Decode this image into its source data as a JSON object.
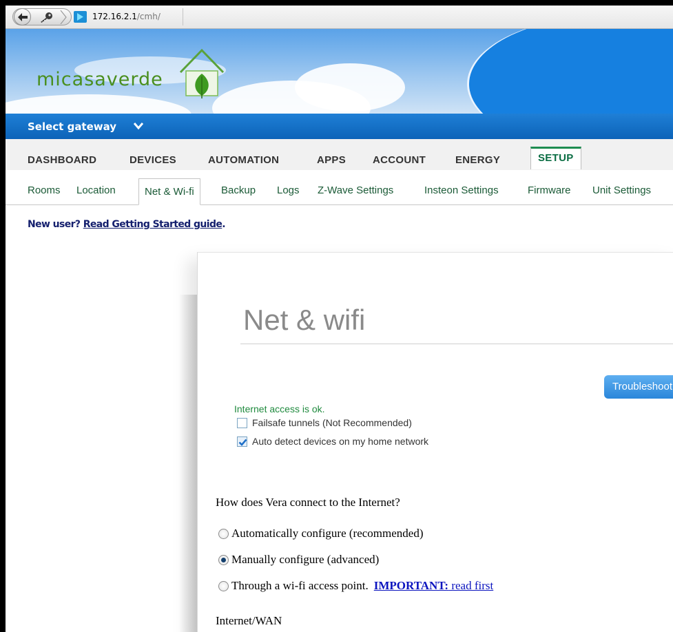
{
  "browser": {
    "url_host": "172.16.2.1",
    "url_path": "/cmh/"
  },
  "header": {
    "logo_text": "micasaverde"
  },
  "gateway": {
    "label": "Select gateway"
  },
  "main_tabs": [
    {
      "label": "DASHBOARD"
    },
    {
      "label": "DEVICES"
    },
    {
      "label": "AUTOMATION"
    },
    {
      "label": "APPS"
    },
    {
      "label": "ACCOUNT"
    },
    {
      "label": "ENERGY"
    },
    {
      "label": "SETUP",
      "active": true
    }
  ],
  "sub_tabs": [
    {
      "label": "Rooms"
    },
    {
      "label": "Location"
    },
    {
      "label": "Net & Wi-fi",
      "active": true
    },
    {
      "label": "Backup"
    },
    {
      "label": "Logs"
    },
    {
      "label": "Z-Wave Settings"
    },
    {
      "label": "Insteon Settings"
    },
    {
      "label": "Firmware"
    },
    {
      "label": "Unit Settings"
    }
  ],
  "getting_started": {
    "prefix": "New user? ",
    "link": "Read Getting Started guide",
    "suffix": "."
  },
  "panel": {
    "title": "Net & wifi",
    "troubleshoot_button": "Troubleshoot",
    "status": "Internet access is ok.",
    "checkboxes": [
      {
        "label": "Failsafe tunnels (Not Recommended)",
        "checked": false
      },
      {
        "label": "Auto detect devices on my home network",
        "checked": true
      }
    ],
    "question": "How does Vera connect to the Internet?",
    "radios": [
      {
        "label": "Automatically configure (recommended)",
        "selected": false
      },
      {
        "label": "Manually configure (advanced)",
        "selected": true
      },
      {
        "label": "Through a wi-fi access point.",
        "selected": false
      }
    ],
    "important_bold": "IMPORTANT:",
    "important_text": " read first",
    "wan_label": "Internet/WAN"
  },
  "colors": {
    "gateway_bar": "#0c63b8",
    "status_ok": "#1f8a3e",
    "link_blue": "#0b14bf",
    "logo_green": "#4a8f1f"
  }
}
